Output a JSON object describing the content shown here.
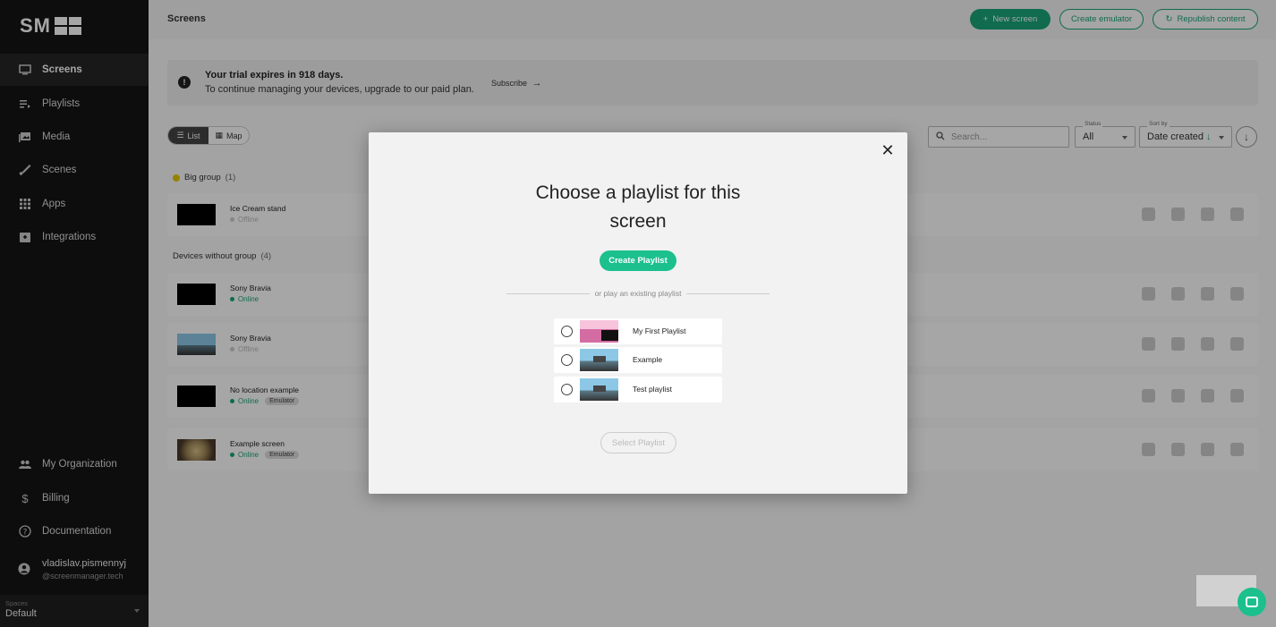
{
  "sidebar": {
    "logo": "SM",
    "items": [
      {
        "label": "Screens",
        "icon": "monitor-icon"
      },
      {
        "label": "Playlists",
        "icon": "playlist-icon"
      },
      {
        "label": "Media",
        "icon": "media-icon"
      },
      {
        "label": "Scenes",
        "icon": "brush-icon"
      },
      {
        "label": "Apps",
        "icon": "grid-icon"
      },
      {
        "label": "Integrations",
        "icon": "integrations-icon"
      }
    ],
    "bottom_items": [
      {
        "label": "My Organization",
        "icon": "people-icon"
      },
      {
        "label": "Billing",
        "icon": "dollar-icon"
      },
      {
        "label": "Documentation",
        "icon": "help-icon"
      }
    ],
    "user": {
      "name": "vladislav.pismennyj",
      "email": "@screenmanager.tech"
    },
    "spaces": {
      "label": "Spaces",
      "value": "Default"
    }
  },
  "header": {
    "title": "Screens",
    "new_screen": "New screen",
    "create_emulator": "Create emulator",
    "republish": "Republish content"
  },
  "trial": {
    "title": "Your trial expires in 918 days.",
    "text": "To continue managing your devices, upgrade to our paid plan.",
    "subscribe": "Subscribe"
  },
  "view_toggle": {
    "list": "List",
    "map": "Map"
  },
  "filters": {
    "search_placeholder": "Search...",
    "status_label": "Status",
    "status_value": "All",
    "sort_label": "Sort by",
    "sort_value": "Date created"
  },
  "groups": [
    {
      "name": "Big group",
      "count": "(1)"
    },
    {
      "name": "Devices without group",
      "count": "(4)"
    }
  ],
  "devices": [
    {
      "name": "Ice Cream stand",
      "status": "Offline",
      "badge": ""
    },
    {
      "name": "Sony Bravia",
      "status": "Online",
      "badge": ""
    },
    {
      "name": "Sony Bravia",
      "status": "Offline",
      "badge": ""
    },
    {
      "name": "No location example",
      "status": "Online",
      "badge": "Emulator"
    },
    {
      "name": "Example screen",
      "status": "Online",
      "badge": "Emulator"
    }
  ],
  "modal": {
    "title_line1": "Choose a playlist for this",
    "title_line2": "screen",
    "create_button": "Create Playlist",
    "divider_text": "or play an existing playlist",
    "playlists": [
      {
        "name": "My First Playlist"
      },
      {
        "name": "Example"
      },
      {
        "name": "Test playlist"
      }
    ],
    "select_button": "Select Playlist"
  },
  "colors": {
    "accent": "#1aa57a",
    "sidebar_bg": "#141414"
  }
}
